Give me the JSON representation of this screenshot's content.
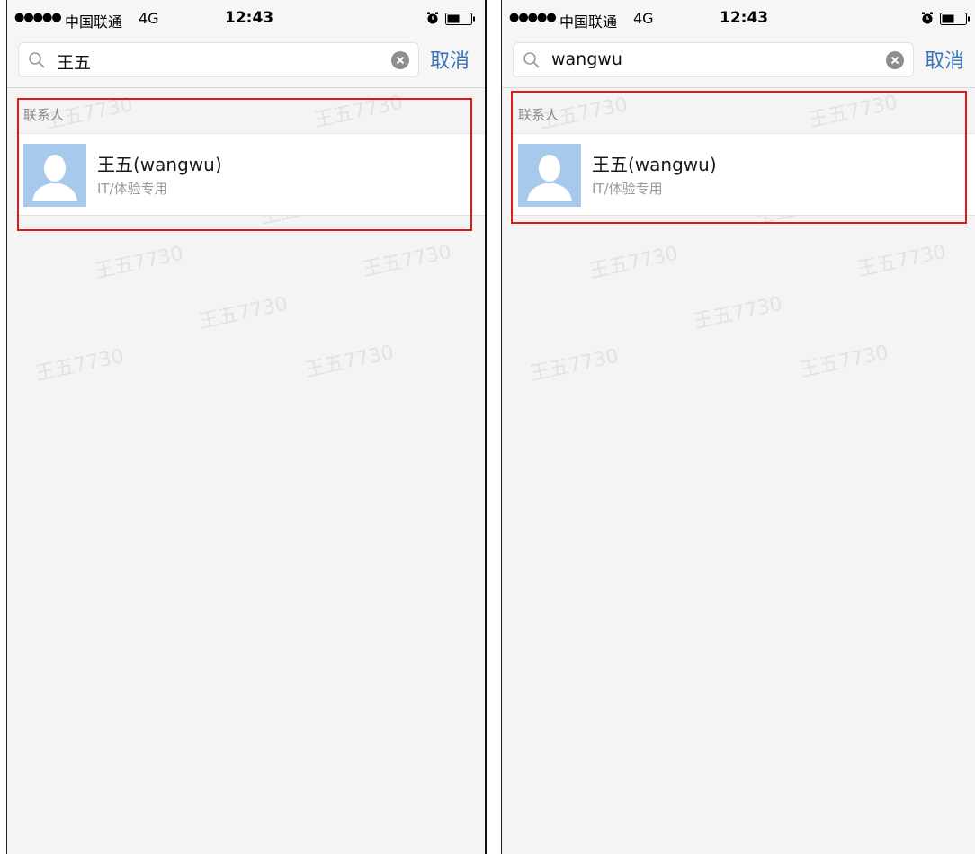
{
  "screens": [
    {
      "status": {
        "signal": "●●●●●",
        "carrier": "中国联通",
        "network": "4G",
        "time": "12:43"
      },
      "search": {
        "value": "王五",
        "cancel_label": "取消"
      },
      "results": {
        "section_label": "联系人",
        "contact_name": "王五(wangwu)",
        "contact_dept": "IT/体验专用"
      },
      "watermark": "王五7730"
    },
    {
      "status": {
        "signal": "●●●●●",
        "carrier": "中国联通",
        "network": "4G",
        "time": "12:43"
      },
      "search": {
        "value": "wangwu",
        "cancel_label": "取消"
      },
      "results": {
        "section_label": "联系人",
        "contact_name": "王五(wangwu)",
        "contact_dept": "IT/体验专用"
      },
      "watermark": "王五7730"
    }
  ],
  "colors": {
    "accent": "#3b74b8",
    "highlight": "#e01818",
    "avatar_bg": "#a6c9ec",
    "page_bg": "#f4f4f4"
  },
  "icons": {
    "search": "search-icon",
    "clear": "clear-icon",
    "alarm": "alarm-icon",
    "battery": "battery-icon",
    "avatar": "person-icon"
  }
}
